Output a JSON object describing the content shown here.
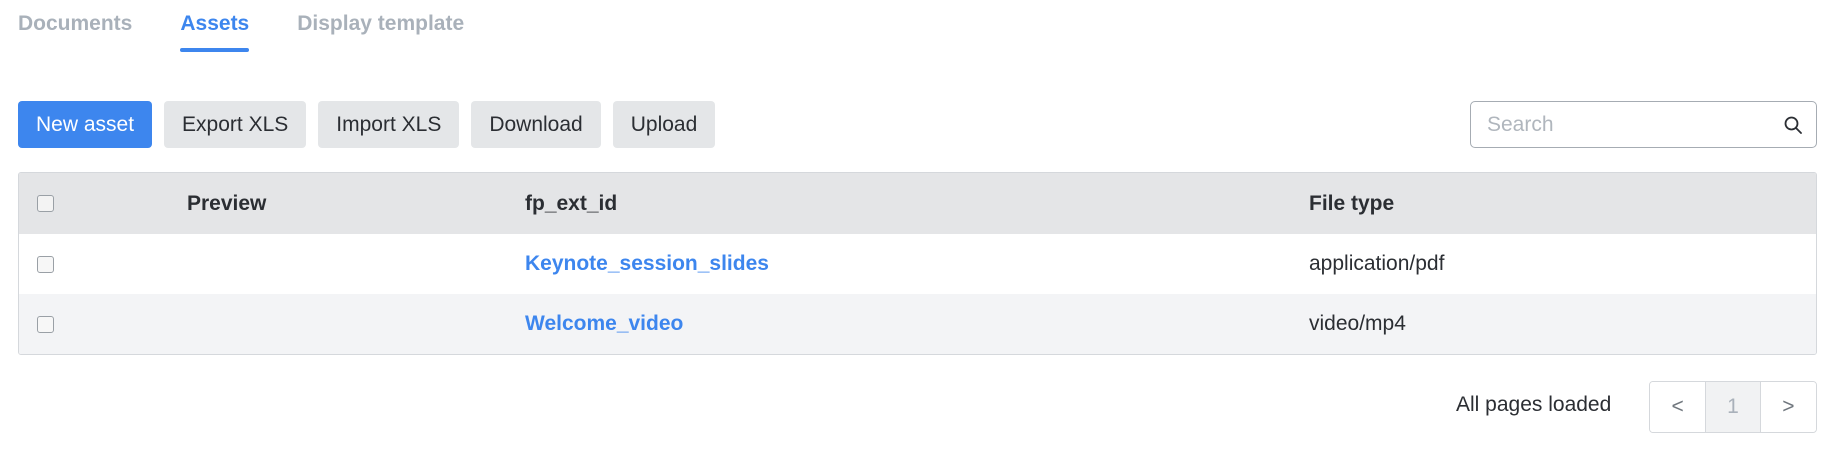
{
  "tabs": [
    {
      "label": "Documents",
      "active": false
    },
    {
      "label": "Assets",
      "active": true
    },
    {
      "label": "Display template",
      "active": false
    }
  ],
  "toolbar": {
    "new_asset": "New asset",
    "export_xls": "Export XLS",
    "import_xls": "Import XLS",
    "download": "Download",
    "upload": "Upload"
  },
  "search": {
    "placeholder": "Search",
    "value": "",
    "icon": "search-icon"
  },
  "table": {
    "columns": {
      "preview": "Preview",
      "ext_id": "fp_ext_id",
      "file_type": "File type"
    },
    "rows": [
      {
        "ext_id": "Keynote_session_slides",
        "file_type": "application/pdf",
        "checked": false
      },
      {
        "ext_id": "Welcome_video",
        "file_type": "video/mp4",
        "checked": false
      }
    ]
  },
  "footer": {
    "status": "All pages loaded",
    "prev": "<",
    "page": "1",
    "next": ">"
  },
  "colors": {
    "accent": "#3d86ee",
    "inactive_tab": "#a9b1ba",
    "button_bg": "#e4e6e8",
    "header_bg": "#e4e5e7",
    "row_alt_bg": "#f3f4f6"
  }
}
